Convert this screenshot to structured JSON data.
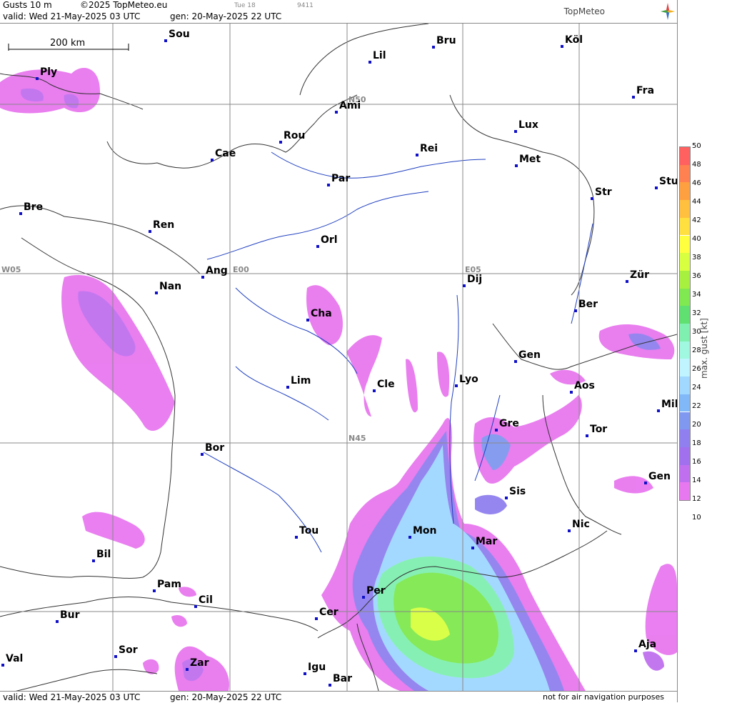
{
  "header": {
    "product": "Gusts 10 m",
    "copyright": "©2025 TopMeteo.eu",
    "day": "Tue 18",
    "code": "9411",
    "valid": "valid:  Wed  21-May-2025  03 UTC",
    "gen": "gen: 20-May-2025 22 UTC",
    "logo": "TopMeteo"
  },
  "footer": {
    "valid": "valid:  Wed  21-May-2025  03 UTC",
    "gen": "gen: 20-May-2025 22 UTC",
    "disclaimer": "not for air navigation purposes"
  },
  "scale": {
    "label": "200 km"
  },
  "grid_labels": {
    "n50": "N50",
    "n45": "N45",
    "w05": "W05",
    "e00": "E00",
    "e05": "E05"
  },
  "cities": [
    {
      "name": "Sou"
    },
    {
      "name": "Bru"
    },
    {
      "name": "Köl"
    },
    {
      "name": "Ply"
    },
    {
      "name": "Lil"
    },
    {
      "name": "Ami"
    },
    {
      "name": "Fra"
    },
    {
      "name": "Lux"
    },
    {
      "name": "Rou"
    },
    {
      "name": "Cae"
    },
    {
      "name": "Rei"
    },
    {
      "name": "Met"
    },
    {
      "name": "Par"
    },
    {
      "name": "Stu"
    },
    {
      "name": "Str"
    },
    {
      "name": "Bre"
    },
    {
      "name": "Ren"
    },
    {
      "name": "Orl"
    },
    {
      "name": "Ang"
    },
    {
      "name": "Nan"
    },
    {
      "name": "Dij"
    },
    {
      "name": "Zür"
    },
    {
      "name": "Cha"
    },
    {
      "name": "Ber"
    },
    {
      "name": "Gen"
    },
    {
      "name": "Lim"
    },
    {
      "name": "Cle"
    },
    {
      "name": "Lyo"
    },
    {
      "name": "Aos"
    },
    {
      "name": "Mil"
    },
    {
      "name": "Gre"
    },
    {
      "name": "Tor"
    },
    {
      "name": "Bor"
    },
    {
      "name": "Sis"
    },
    {
      "name": "Gen"
    },
    {
      "name": "Tou"
    },
    {
      "name": "Mon"
    },
    {
      "name": "Nic"
    },
    {
      "name": "Mar"
    },
    {
      "name": "Bil"
    },
    {
      "name": "Pam"
    },
    {
      "name": "Per"
    },
    {
      "name": "Cil"
    },
    {
      "name": "Bur"
    },
    {
      "name": "Cer"
    },
    {
      "name": "Sor"
    },
    {
      "name": "Aja"
    },
    {
      "name": "Val"
    },
    {
      "name": "Zar"
    },
    {
      "name": "Igu"
    },
    {
      "name": "Bar"
    }
  ],
  "legend": {
    "title": "max. gust  [kt]",
    "ticks": [
      "50",
      "48",
      "46",
      "44",
      "42",
      "40",
      "38",
      "36",
      "34",
      "32",
      "30",
      "28",
      "26",
      "24",
      "22",
      "20",
      "18",
      "16",
      "14",
      "12",
      "10"
    ],
    "colors": [
      "#ff6060",
      "#ff8050",
      "#ffa040",
      "#ffc040",
      "#ffe040",
      "#ffff40",
      "#d8ff40",
      "#a8f040",
      "#80e850",
      "#60e070",
      "#80f0b0",
      "#a0f8e0",
      "#c0f4ff",
      "#a0d8ff",
      "#80b8f8",
      "#8098ef",
      "#9080ef",
      "#a070ef",
      "#c070ef",
      "#e878ef"
    ]
  }
}
